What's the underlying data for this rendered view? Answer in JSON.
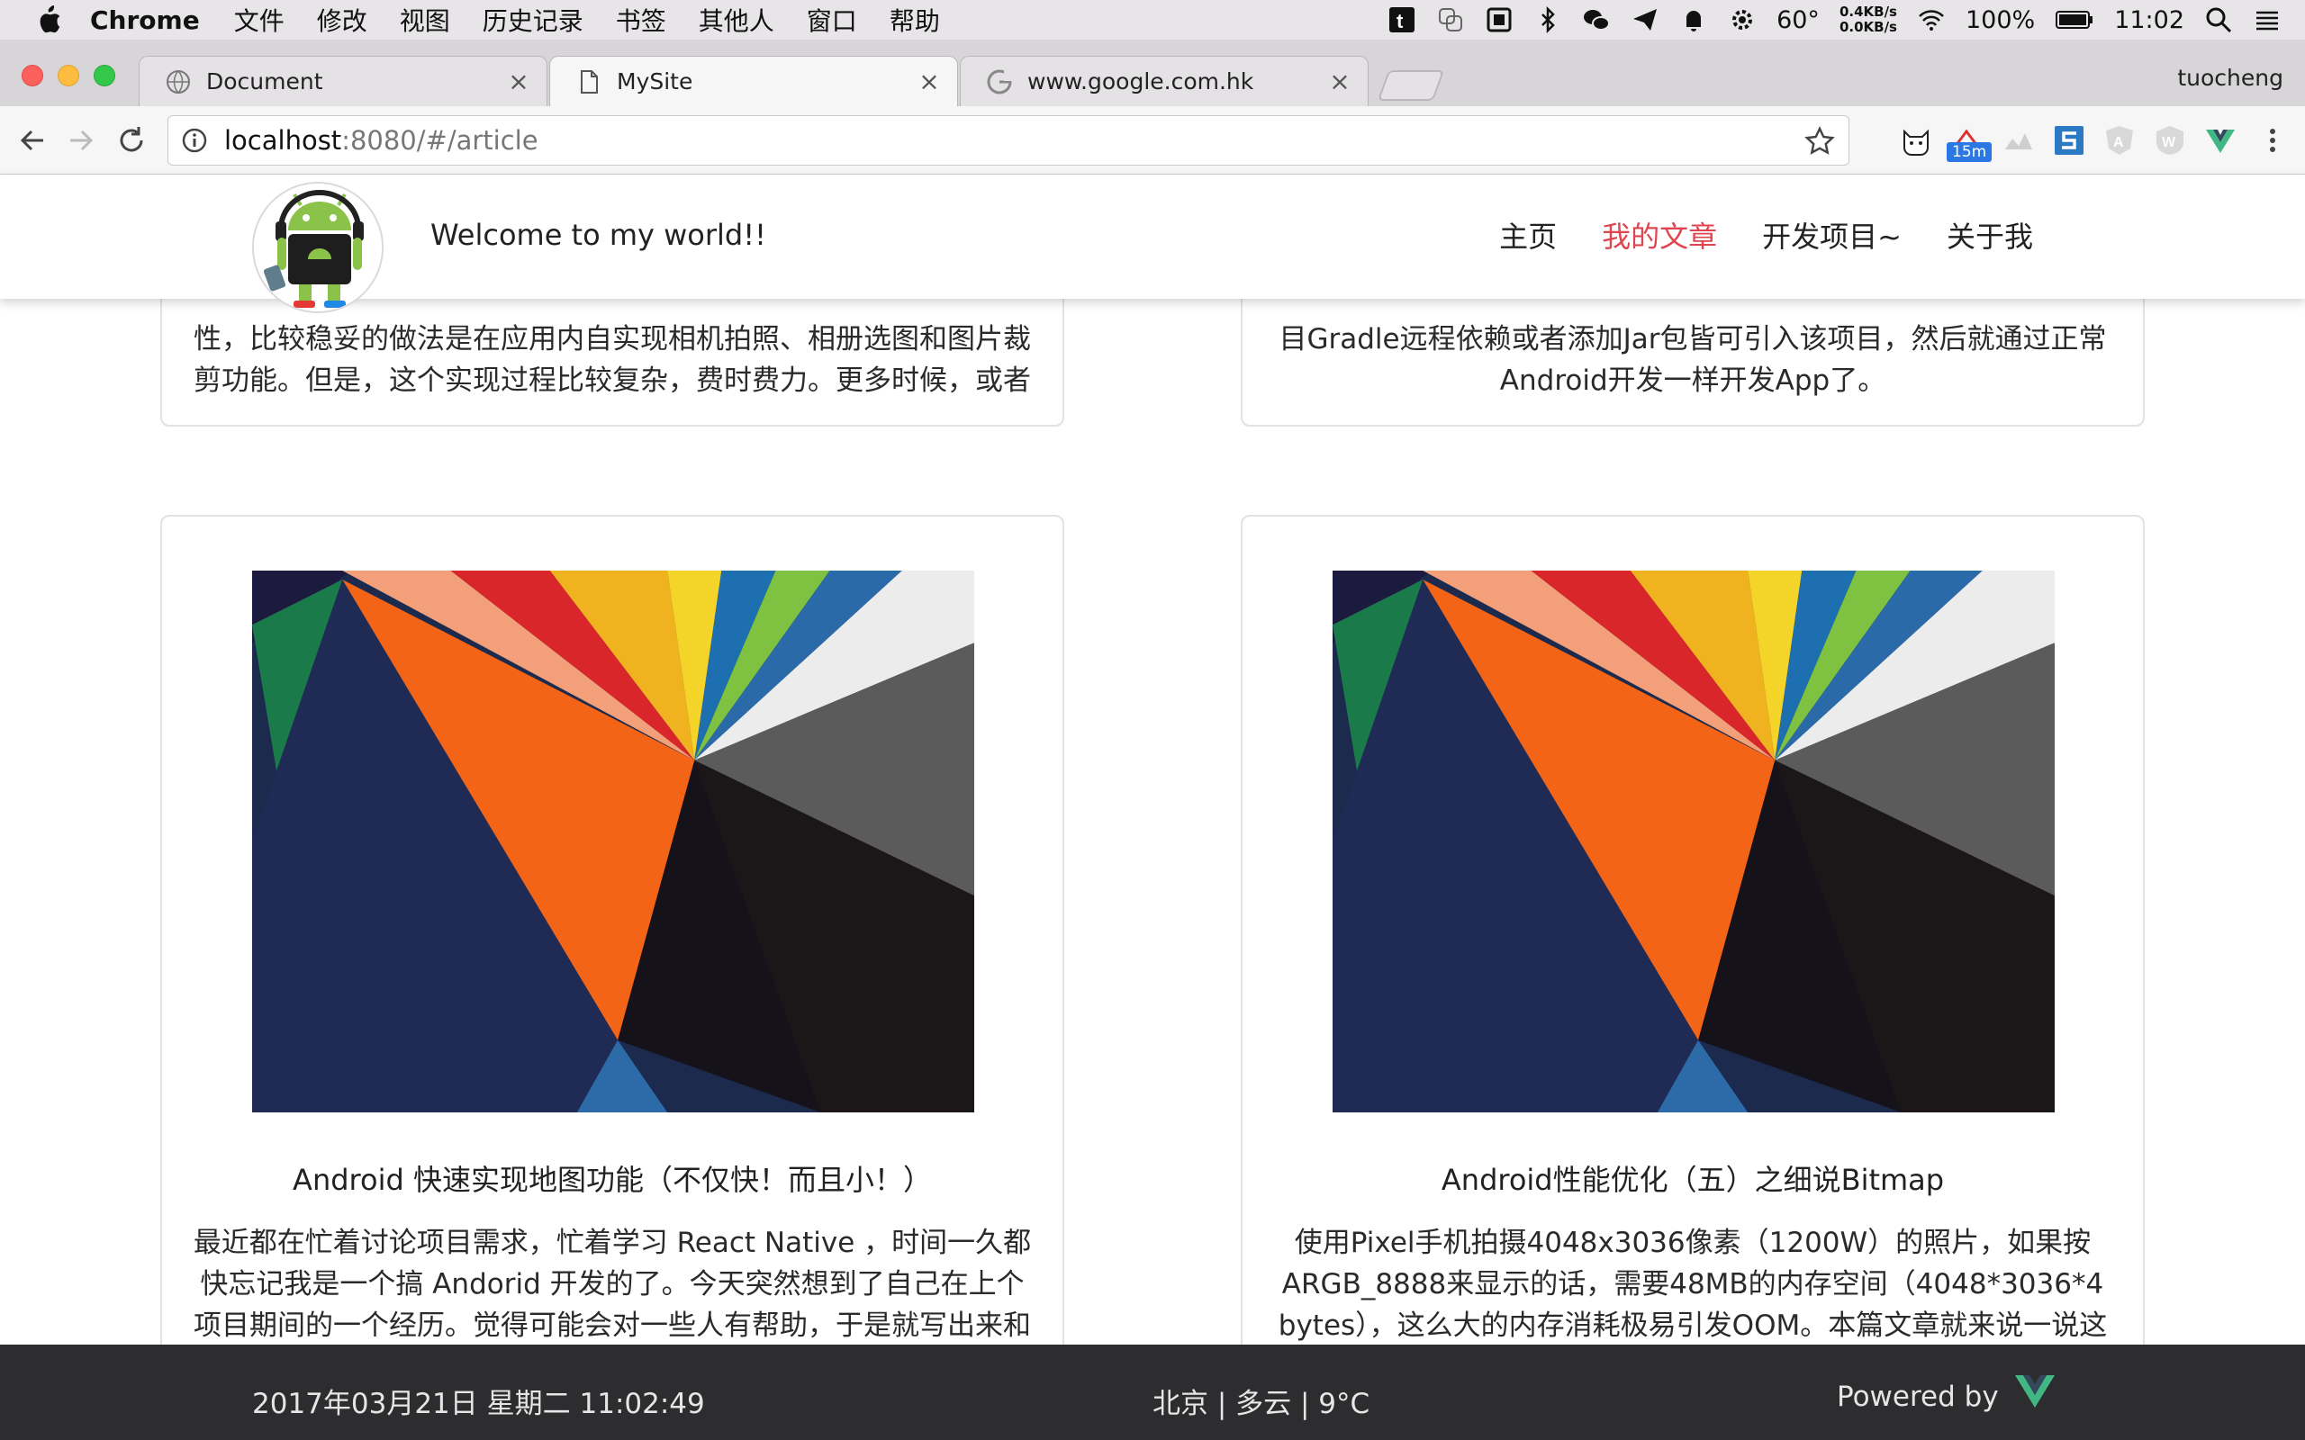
{
  "menubar": {
    "app_name": "Chrome",
    "items": [
      "文件",
      "修改",
      "视图",
      "历史记录",
      "书签",
      "其他人",
      "窗口",
      "帮助"
    ],
    "temperature": "60°",
    "net_up": "0.4KB/s",
    "net_down": "0.0KB/s",
    "battery": "100%",
    "time": "11:02",
    "tray_icons": [
      "t-icon",
      "tile-icon",
      "puzzle-icon",
      "bluetooth-icon",
      "wechat-icon",
      "send-icon",
      "bell-icon",
      "sun-icon",
      "wifi-icon",
      "battery-icon",
      "search-icon",
      "list-icon"
    ]
  },
  "tabs": [
    {
      "title": "Document",
      "icon": "globe-icon",
      "close": "×"
    },
    {
      "title": "MySite",
      "icon": "page-icon",
      "close": "×"
    },
    {
      "title": "www.google.com.hk",
      "icon": "google-icon",
      "close": "×"
    }
  ],
  "profile": "tuocheng",
  "omnibox": {
    "host": "localhost",
    "path": ":8080/#/article"
  },
  "extensions": {
    "badge": "15m"
  },
  "site": {
    "welcome": "Welcome to my world!!",
    "nav": [
      "主页",
      "我的文章",
      "开发项目~",
      "关于我"
    ],
    "active_nav": "我的文章"
  },
  "cards_top": [
    {
      "lines": [
        "性，比较稳妥的做法是在应用内自实现相机拍照、相册选图和图片裁",
        "剪功能。但是，这个实现过程比较复杂，费时费力。更多时候，或者"
      ]
    },
    {
      "lines": [
        "目Gradle远程依赖或者添加Jar包皆可引入该项目，然后就通过正常",
        "Android开发一样开发App了。"
      ]
    }
  ],
  "cards_bottom": [
    {
      "title": "Android 快速实现地图功能（不仅快！而且小！）",
      "lines": [
        "最近都在忙着讨论项目需求，忙着学习 React Native ，时间一久都",
        "快忘记我是一个搞 Andorid 开发的了。今天突然想到了自己在上个",
        "项目期间的一个经历。觉得可能会对一些人有帮助，于是就写出来和"
      ]
    },
    {
      "title": "Android性能优化（五）之细说Bitmap",
      "lines": [
        "使用Pixel手机拍摄4048x3036像素（1200W）的照片，如果按",
        "ARGB_8888来显示的话，需要48MB的内存空间（4048*3036*4",
        "bytes），这么大的内存消耗极易引发OOM。本篇文章就来说一说这"
      ]
    }
  ],
  "footer": {
    "date": "2017年03月21日 星期二 11:02:49",
    "weather": "北京 | 多云 | 9°C",
    "powered": "Powered by"
  },
  "colors": {
    "accent": "#e0454f",
    "footer_bg": "#2d2d2f",
    "vue_green": "#41b883"
  }
}
